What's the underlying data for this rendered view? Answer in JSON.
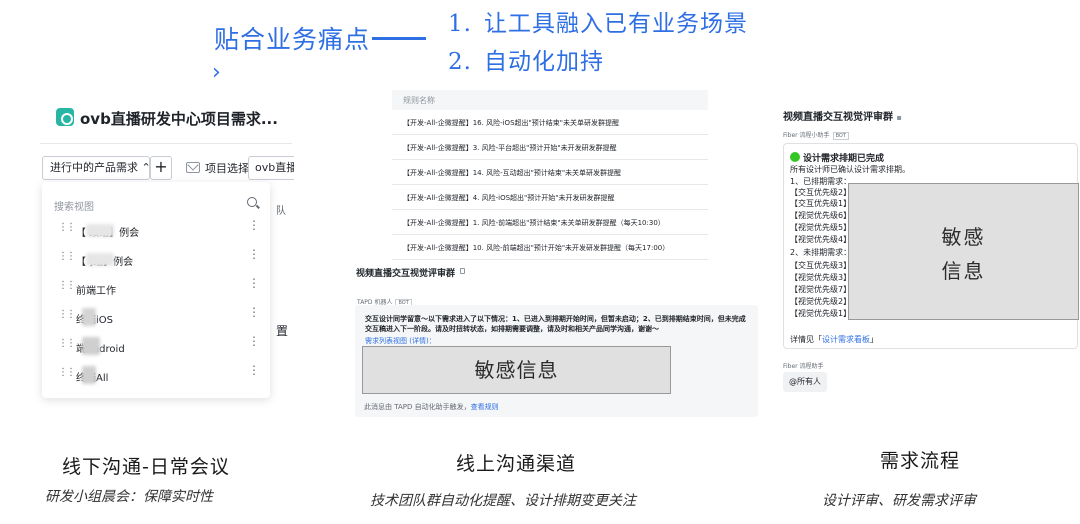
{
  "header": {
    "title": "贴合业务痛点",
    "items": [
      {
        "num": "1.",
        "text": "让工具融入已有业务场景"
      },
      {
        "num": "2.",
        "text": "自动化加持"
      }
    ]
  },
  "panel1": {
    "title": "ovb直播研发中心项目需求...",
    "view_select": "进行中的产品需求 ⌃",
    "add": "+",
    "project_select": "项目选择",
    "tab": "ovb直播",
    "bg_text_a": "队",
    "bg_text_b": "置",
    "search_placeholder": "搜索视图",
    "views": [
      {
        "label": "【        改组】例会"
      },
      {
        "label": "【        ]组】例会"
      },
      {
        "label": "前端工作"
      },
      {
        "label": "    终端iOS"
      },
      {
        "label": "    端Android"
      },
      {
        "label": "    终端All"
      }
    ]
  },
  "panel2": {
    "table_header": "规则名称",
    "rules": [
      "【开发-All-企微提醒】16. 风险-iOS超出\"预计结束\"未关单研发群提醒",
      "【开发-All-企微提醒】3. 风险-平台超出\"预计开始\"未开发研发群提醒",
      "【开发-All-企微提醒】14. 风险-互动超出\"预计结束\"未关单研发群提醒",
      "【开发-All-企微提醒】4. 风险-iOS超出\"预计开始\"未开发研发群提醒",
      "【开发-All-企微提醒】1. 风险-前端超出\"预计结束\"未关单研发群提醒（每天10:30）",
      "【开发-All-企微提醒】10. 风险-前端超出\"预计开始\"未开发研发群提醒（每天17:00）"
    ],
    "group_name": "视频直播交互视觉评审群",
    "bot_name": "TAPD 机器人",
    "bot_tag": "BOT",
    "message": "交互设计同学留意～以下需求进入了以下情况：1、已进入到排期开始时间，但暂未启动；2、已到排期结束时间，但未完成交互稿进入下一阶段。请及时扭转状态，如排期需要调整，请及时和相关产品同学沟通，谢谢～",
    "link": "需求列表视图 (详情)：",
    "sensitive": "敏感信息",
    "footer": "此消息由 TAPD 自动化助手触发，",
    "footer_link": "查看规则"
  },
  "panel3": {
    "title": "视频直播交互视觉评审群",
    "bot_name": "Fiber 流程小助手",
    "bot_tag": "BOT",
    "card_title": "设计需求排期已完成",
    "lines": [
      "所有设计师已确认设计需求排期。",
      "1、已排期需求：",
      "【交互优先级2】",
      "【交互优先级1】",
      "【视觉优先级6】",
      "【视觉优先级5】",
      "【视觉优先级4】",
      "2、未排期需求：",
      "【交互优先级3】",
      "【视觉优先级3】",
      "【视觉优先级7】",
      "【视觉优先级2】",
      "【视觉优先级1】"
    ],
    "sensitive_line1": "敏感",
    "sensitive_line2": "信息",
    "detail_prefix": "详情见「",
    "detail_link": "设计需求看板",
    "detail_suffix": "」",
    "helper": "Fiber 流程助手",
    "mention": "@所有人"
  },
  "captions": [
    {
      "title": "线下沟通-日常会议",
      "subtitle": "研发小组晨会：保障实时性"
    },
    {
      "title": "线上沟通渠道",
      "subtitle": "技术团队群自动化提醒、设计排期变更关注"
    },
    {
      "title": "需求流程",
      "subtitle": "设计评审、研发需求评审"
    }
  ]
}
